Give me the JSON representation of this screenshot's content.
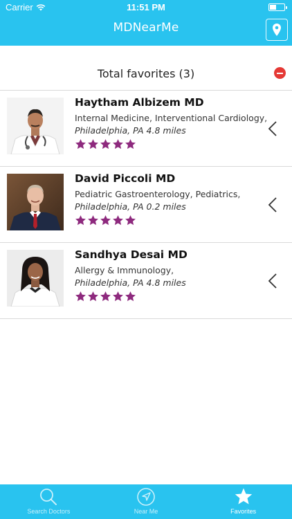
{
  "status_bar": {
    "carrier": "Carrier",
    "time": "11:51 PM"
  },
  "nav": {
    "title": "MDNearMe",
    "map_button_icon": "map-pin-icon"
  },
  "favorites": {
    "summary": "Total favorites (3)",
    "remove_all_icon": "remove-circle-icon"
  },
  "doctors": [
    {
      "name": "Haytham Albizem MD",
      "specialties": "Internal Medicine,  Interventional Cardiology,",
      "location": "Philadelphia, PA 4.8 miles",
      "rating": 5
    },
    {
      "name": "David Piccoli MD",
      "specialties": "Pediatric Gastroenterology,  Pediatrics,",
      "location": "Philadelphia, PA 0.2 miles",
      "rating": 5
    },
    {
      "name": "Sandhya Desai MD",
      "specialties": "Allergy & Immunology,",
      "location": "Philadelphia, PA 4.8 miles",
      "rating": 5
    }
  ],
  "tabs": [
    {
      "label": "Search Doctors",
      "icon": "search-icon",
      "active": false
    },
    {
      "label": "Near Me",
      "icon": "navigation-arrow-icon",
      "active": false
    },
    {
      "label": "Favorites",
      "icon": "star-icon",
      "active": true
    }
  ],
  "colors": {
    "brand": "#29c3ef",
    "star": "#8e2a7e",
    "remove": "#e53935"
  }
}
